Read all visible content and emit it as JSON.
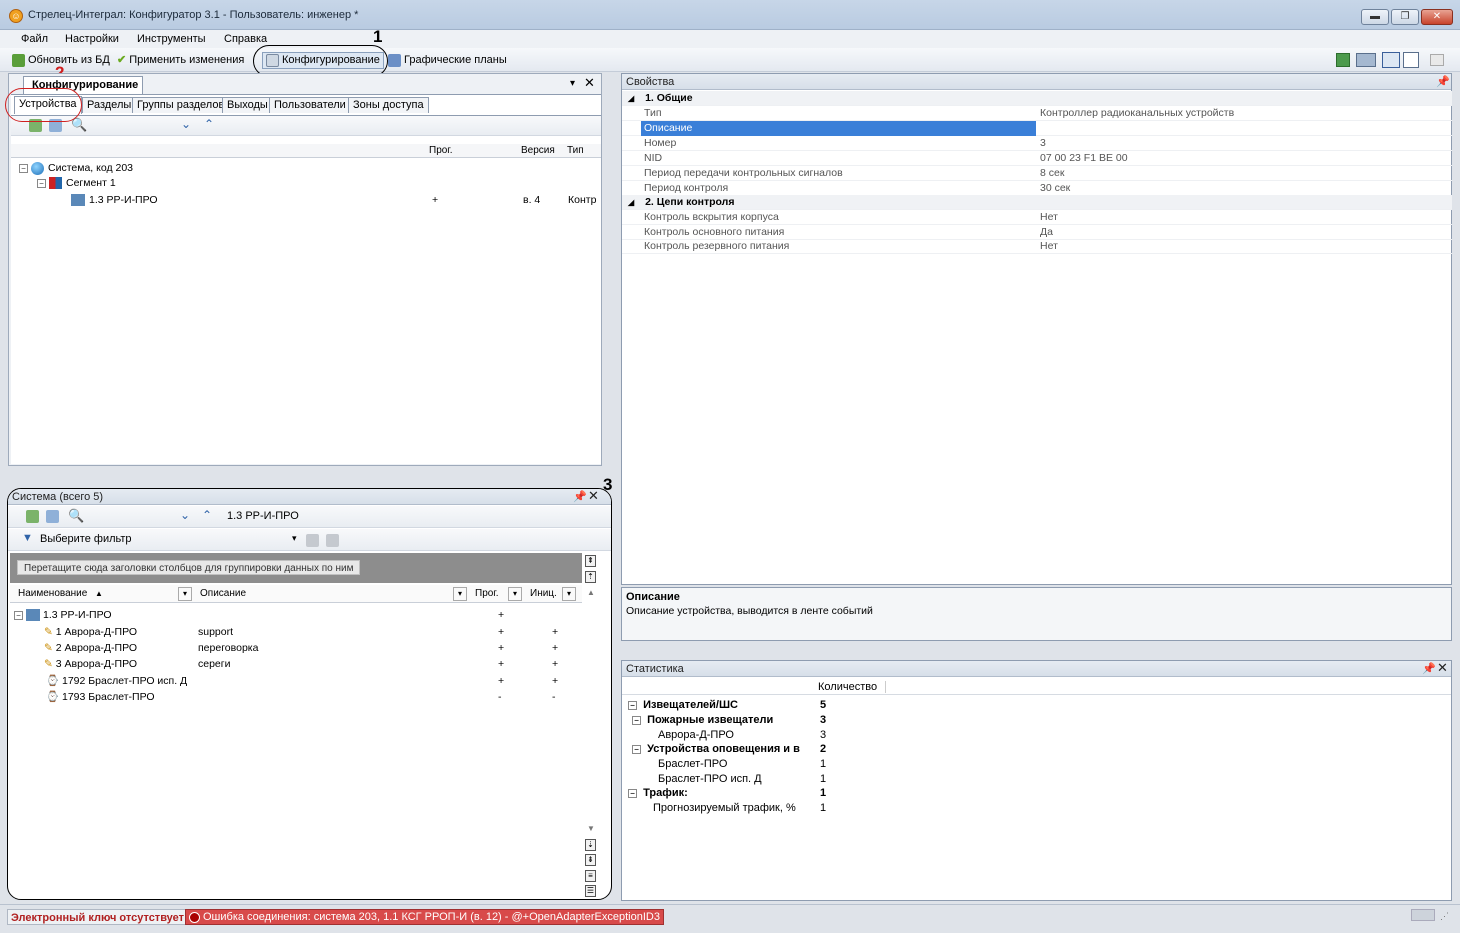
{
  "window": {
    "title": "Стрелец-Интеграл: Конфигуратор 3.1 - Пользователь: инженер *"
  },
  "menu": [
    "Файл",
    "Настройки",
    "Инструменты",
    "Справка"
  ],
  "toolbar": {
    "refresh_db": "Обновить из БД",
    "apply": "Применить изменения",
    "configure": "Конфигурирование",
    "plans": "Графические планы"
  },
  "annotations": {
    "a1": "1",
    "a2": "2",
    "a3": "3"
  },
  "config_panel": {
    "title": "Конфигурирование",
    "tabs": [
      "Устройства",
      "Разделы",
      "Группы разделов",
      "Выходы",
      "Пользователи",
      "Зоны доступа"
    ],
    "columns": {
      "prog": "Прог.",
      "version": "Версия",
      "type": "Тип"
    },
    "tree": [
      {
        "label": "Система, код 203",
        "prog": "",
        "version": "",
        "type": ""
      },
      {
        "label": "Сегмент 1",
        "prog": "",
        "version": "",
        "type": ""
      },
      {
        "label": "1.3 РР-И-ПРО",
        "prog": "+",
        "version": "в. 4",
        "type": "Контр"
      }
    ]
  },
  "system_panel": {
    "title": "Система (всего 5)",
    "breadcrumb": "1.3 РР-И-ПРО",
    "filter": "Выберите фильтр",
    "group_hint": "Перетащите сюда заголовки столбцов для группировки данных по ним",
    "columns": {
      "name": "Наименование",
      "desc": "Описание",
      "prog": "Прог.",
      "init": "Иниц."
    },
    "rows": [
      {
        "name": "1.3 РР-И-ПРО",
        "desc": "",
        "prog": "+",
        "init": ""
      },
      {
        "name": "1 Аврора-Д-ПРО",
        "desc": "support",
        "prog": "+",
        "init": "+"
      },
      {
        "name": "2 Аврора-Д-ПРО",
        "desc": "переговорка",
        "prog": "+",
        "init": "+"
      },
      {
        "name": "3 Аврора-Д-ПРО",
        "desc": "сереги",
        "prog": "+",
        "init": "+"
      },
      {
        "name": "1792 Браслет-ПРО исп. Д",
        "desc": "",
        "prog": "+",
        "init": "+"
      },
      {
        "name": "1793 Браслет-ПРО",
        "desc": "",
        "prog": "-",
        "init": "-"
      }
    ]
  },
  "properties": {
    "title": "Свойства",
    "groups": [
      {
        "name": "1. Общие",
        "rows": [
          {
            "k": "Тип",
            "v": "Контроллер радиоканальных устройств"
          },
          {
            "k": "Описание",
            "v": ""
          },
          {
            "k": "Номер",
            "v": "3"
          },
          {
            "k": "NID",
            "v": "07 00 23 F1 BE 00"
          },
          {
            "k": "Период передачи контрольных сигналов",
            "v": "8 сек"
          },
          {
            "k": "Период контроля",
            "v": "30 сек"
          }
        ]
      },
      {
        "name": "2. Цепи контроля",
        "rows": [
          {
            "k": "Контроль вскрытия корпуса",
            "v": "Нет"
          },
          {
            "k": "Контроль основного питания",
            "v": "Да"
          },
          {
            "k": "Контроль резервного питания",
            "v": "Нет"
          }
        ]
      }
    ]
  },
  "description": {
    "title": "Описание",
    "text": "Описание устройства, выводится в ленте событий"
  },
  "statistics": {
    "title": "Статистика",
    "col": "Количество",
    "rows": [
      {
        "label": "Извещателей/ШС",
        "value": "5",
        "bold": true
      },
      {
        "label": "Пожарные извещатели",
        "value": "3",
        "bold": true
      },
      {
        "label": "Аврора-Д-ПРО",
        "value": "3",
        "bold": false
      },
      {
        "label": "Устройства оповещения и в",
        "value": "2",
        "bold": true
      },
      {
        "label": "Браслет-ПРО",
        "value": "1",
        "bold": false
      },
      {
        "label": "Браслет-ПРО исп. Д",
        "value": "1",
        "bold": false
      },
      {
        "label": "Трафик:",
        "value": "1",
        "bold": true
      },
      {
        "label": "Прогнозируемый трафик, %",
        "value": "1",
        "bold": false
      }
    ]
  },
  "status": {
    "key": "Электронный ключ отсутствует",
    "error": "Ошибка соединения:  система 203, 1.1 КСГ РРОП-И (в. 12) - @+OpenAdapterExceptionID3"
  }
}
